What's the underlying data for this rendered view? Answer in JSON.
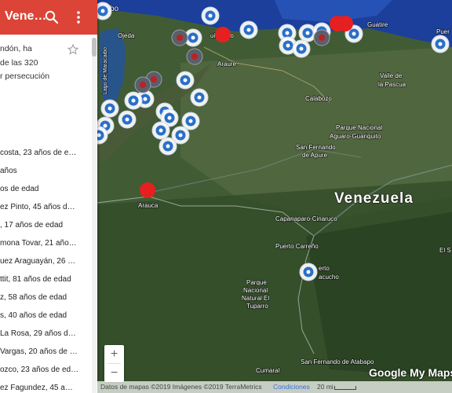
{
  "panel": {
    "title": "Vene…",
    "description_lines": [
      "ndón, ha",
      "de las 320",
      "r persecución"
    ],
    "items": [
      "costa, 23 años de e…",
      "años",
      "os de edad",
      "ez Pinto, 45 años d…",
      ", 17 años de edad",
      "mona Tovar, 21 año…",
      "uez Araguayán, 26 …",
      "ttit, 81 años de edad",
      "z, 58 años de edad",
      "s, 40 años de edad",
      "La Rosa, 29 años d…",
      "Vargas, 20 años de …",
      "ozco, 23 años de ed…",
      "ez Fagundez, 45 a…"
    ]
  },
  "map": {
    "labels": {
      "country": "Venezuela",
      "aruba": "bo",
      "ojeda": "Ojeda",
      "barquisimeto": "uisimeto",
      "guatire": "Guatire",
      "puerto": "Puer",
      "lake": "Lago de Maracaibo",
      "araure": "Araure",
      "valle": "Valle de",
      "pascua": "la Pascua",
      "calabozo": "Calabozo",
      "parque_aguaro_1": "Parque Nacional",
      "parque_aguaro_2": "Aguaro-Guariquito",
      "sanfernando_1": "San Fernando",
      "sanfernando_2": "de Apure",
      "arauca": "Arauca",
      "capanaparo": "Capanaparo-Cinaruco",
      "puerto_carreno": "Puerto Carreño",
      "puerto_ayacucho_1": "erto",
      "puerto_ayacucho_2": "acucho",
      "parque_tuparro_1": "Parque",
      "parque_tuparro_2": "Nacional",
      "parque_tuparro_3": "Natural El",
      "parque_tuparro_4": "Tuparro",
      "cumaral": "Cumaral",
      "san_fernando_atabapo": "San Fernando de Atabapo",
      "el_s": "El S"
    }
  },
  "zoom": {
    "in": "+",
    "out": "−"
  },
  "footer": {
    "data": "Datos de mapas ©2019 Imágenes ©2019 TerraMetrics",
    "conditions": "Condiciones",
    "scale": "20 mi"
  },
  "logo": "Google My Maps",
  "colors": {
    "header": "#db4437",
    "marker": "#ffffff",
    "marker_icon": "#2a6fc9",
    "red_marker": "#e62020",
    "sea": "#1b3f9b"
  }
}
